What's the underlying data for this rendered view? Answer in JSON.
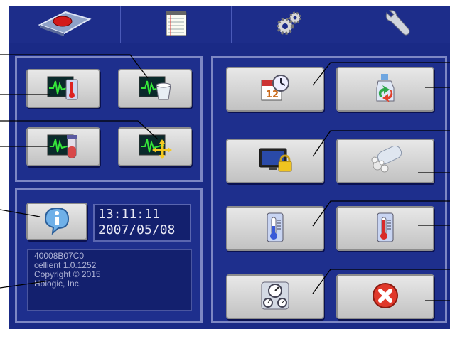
{
  "tabs": [
    {
      "icon": "sample-tray-icon"
    },
    {
      "icon": "notepad-icon"
    },
    {
      "icon": "gears-icon"
    },
    {
      "icon": "wrench-icon"
    }
  ],
  "diagnostics": {
    "buttons": [
      {
        "icon": "monitor-thermometer-icon"
      },
      {
        "icon": "monitor-waste-icon"
      },
      {
        "icon": "monitor-vial-icon"
      },
      {
        "icon": "monitor-move-icon"
      }
    ]
  },
  "status": {
    "time": "13:11:11",
    "date": "2007/05/08",
    "info_lines": [
      "40008B07C0",
      "cellient 1.0.1252",
      "Copyright © 2015",
      "Hologic, Inc."
    ]
  },
  "settings": {
    "buttons": [
      {
        "icon": "calendar-clock-icon"
      },
      {
        "icon": "reagent-bottle-icon"
      },
      {
        "icon": "screen-lock-icon"
      },
      {
        "icon": "cleaning-icon"
      },
      {
        "icon": "thermometer-cold-icon"
      },
      {
        "icon": "thermometer-hot-icon"
      },
      {
        "icon": "gauges-icon"
      },
      {
        "icon": "exit-icon"
      }
    ]
  },
  "colors": {
    "screen": "#1a2a86",
    "panel_border": "#7d87c4",
    "button": "#d4d4d4",
    "callout": "#000000"
  }
}
